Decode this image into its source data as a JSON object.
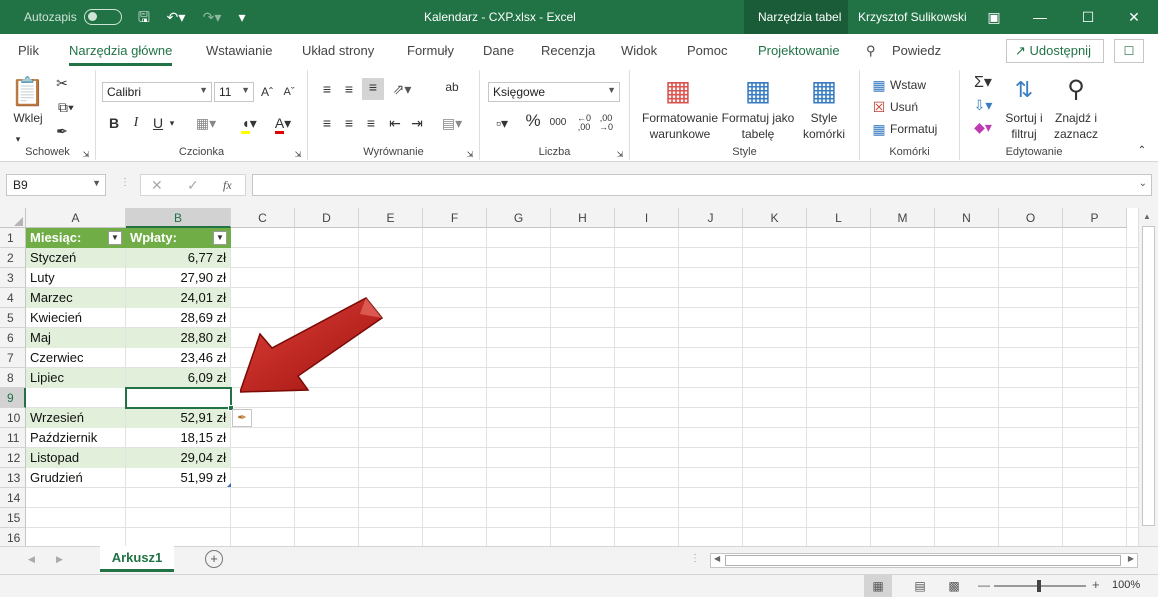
{
  "window": {
    "autosave_label": "Autozapis",
    "title": "Kalendarz - CXP.xlsx - Excel",
    "context_tab": "Narzędzia tabel",
    "user": "Krzysztof Sulikowski"
  },
  "ribbon_tabs": [
    "Plik",
    "Narzędzia główne",
    "Wstawianie",
    "Układ strony",
    "Formuły",
    "Dane",
    "Recenzja",
    "Widok",
    "Pomoc",
    "Projektowanie"
  ],
  "tell_me": "Powiedz",
  "share_label": "Udostępnij",
  "clipboard": {
    "paste_label": "Wklej",
    "group_label": "Schowek"
  },
  "font": {
    "name": "Calibri",
    "size": "11",
    "group_label": "Czcionka",
    "bold": "B",
    "italic": "I",
    "underline": "U"
  },
  "alignment": {
    "group_label": "Wyrównanie",
    "wrap": "ab"
  },
  "number": {
    "format": "Księgowe",
    "group_label": "Liczba",
    "percent": "%",
    "thousands": "000"
  },
  "styles": {
    "cond_format": [
      "Formatowanie",
      "warunkowe"
    ],
    "format_table": [
      "Formatuj jako",
      "tabelę"
    ],
    "cell_styles": [
      "Style",
      "komórki"
    ],
    "group_label": "Style"
  },
  "cells": {
    "insert": "Wstaw",
    "delete": "Usuń",
    "format": "Formatuj",
    "group_label": "Komórki"
  },
  "editing": {
    "sort": [
      "Sortuj i",
      "filtruj"
    ],
    "find": [
      "Znajdź i",
      "zaznacz"
    ],
    "group_label": "Edytowanie"
  },
  "formula_bar": {
    "name_box": "B9",
    "fx": "fx",
    "value": ""
  },
  "columns": [
    "A",
    "B",
    "C",
    "D",
    "E",
    "F",
    "G",
    "H",
    "I",
    "J",
    "K",
    "L",
    "M",
    "N",
    "O",
    "P"
  ],
  "rows": [
    "1",
    "2",
    "3",
    "4",
    "5",
    "6",
    "7",
    "8",
    "9",
    "10",
    "11",
    "12",
    "13",
    "14",
    "15",
    "16"
  ],
  "table": {
    "header": [
      "Miesiąc:",
      "Wpłaty:"
    ],
    "data": [
      [
        "Styczeń",
        "6,77 zł"
      ],
      [
        "Luty",
        "27,90 zł"
      ],
      [
        "Marzec",
        "24,01 zł"
      ],
      [
        "Kwiecień",
        "28,69 zł"
      ],
      [
        "Maj",
        "28,80 zł"
      ],
      [
        "Czerwiec",
        "23,46 zł"
      ],
      [
        "Lipiec",
        "6,09 zł"
      ],
      [
        "",
        ""
      ],
      [
        "Wrzesień",
        "52,91 zł"
      ],
      [
        "Październik",
        "18,15 zł"
      ],
      [
        "Listopad",
        "29,04 zł"
      ],
      [
        "Grudzień",
        "51,99 zł"
      ]
    ]
  },
  "selected_cell": "B9",
  "sheet_tab": "Arkusz1",
  "zoom": "100%",
  "colors": {
    "accent": "#217346",
    "table_header": "#70ad47",
    "band": "#e2efda",
    "arrow": "#c0201a"
  }
}
